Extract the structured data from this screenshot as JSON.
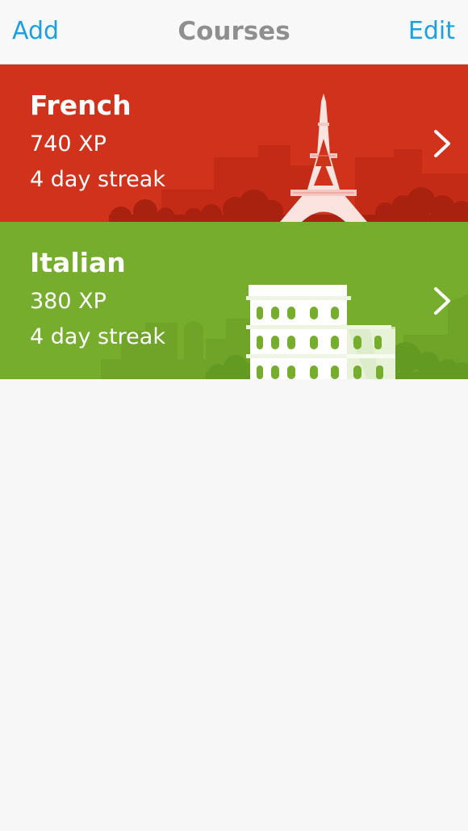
{
  "navbar": {
    "add_label": "Add",
    "title": "Courses",
    "edit_label": "Edit"
  },
  "courses": [
    {
      "name": "French",
      "xp": "740 XP",
      "streak": "4 day streak",
      "color": "#d1321b",
      "landmark": "eiffel-tower"
    },
    {
      "name": "Italian",
      "xp": "380 XP",
      "streak": "4 day streak",
      "color": "#77ad2c",
      "landmark": "colosseum"
    }
  ],
  "colors": {
    "accent": "#1ca0e2",
    "title_gray": "#8f8f8f",
    "background": "#f7f7f7"
  }
}
